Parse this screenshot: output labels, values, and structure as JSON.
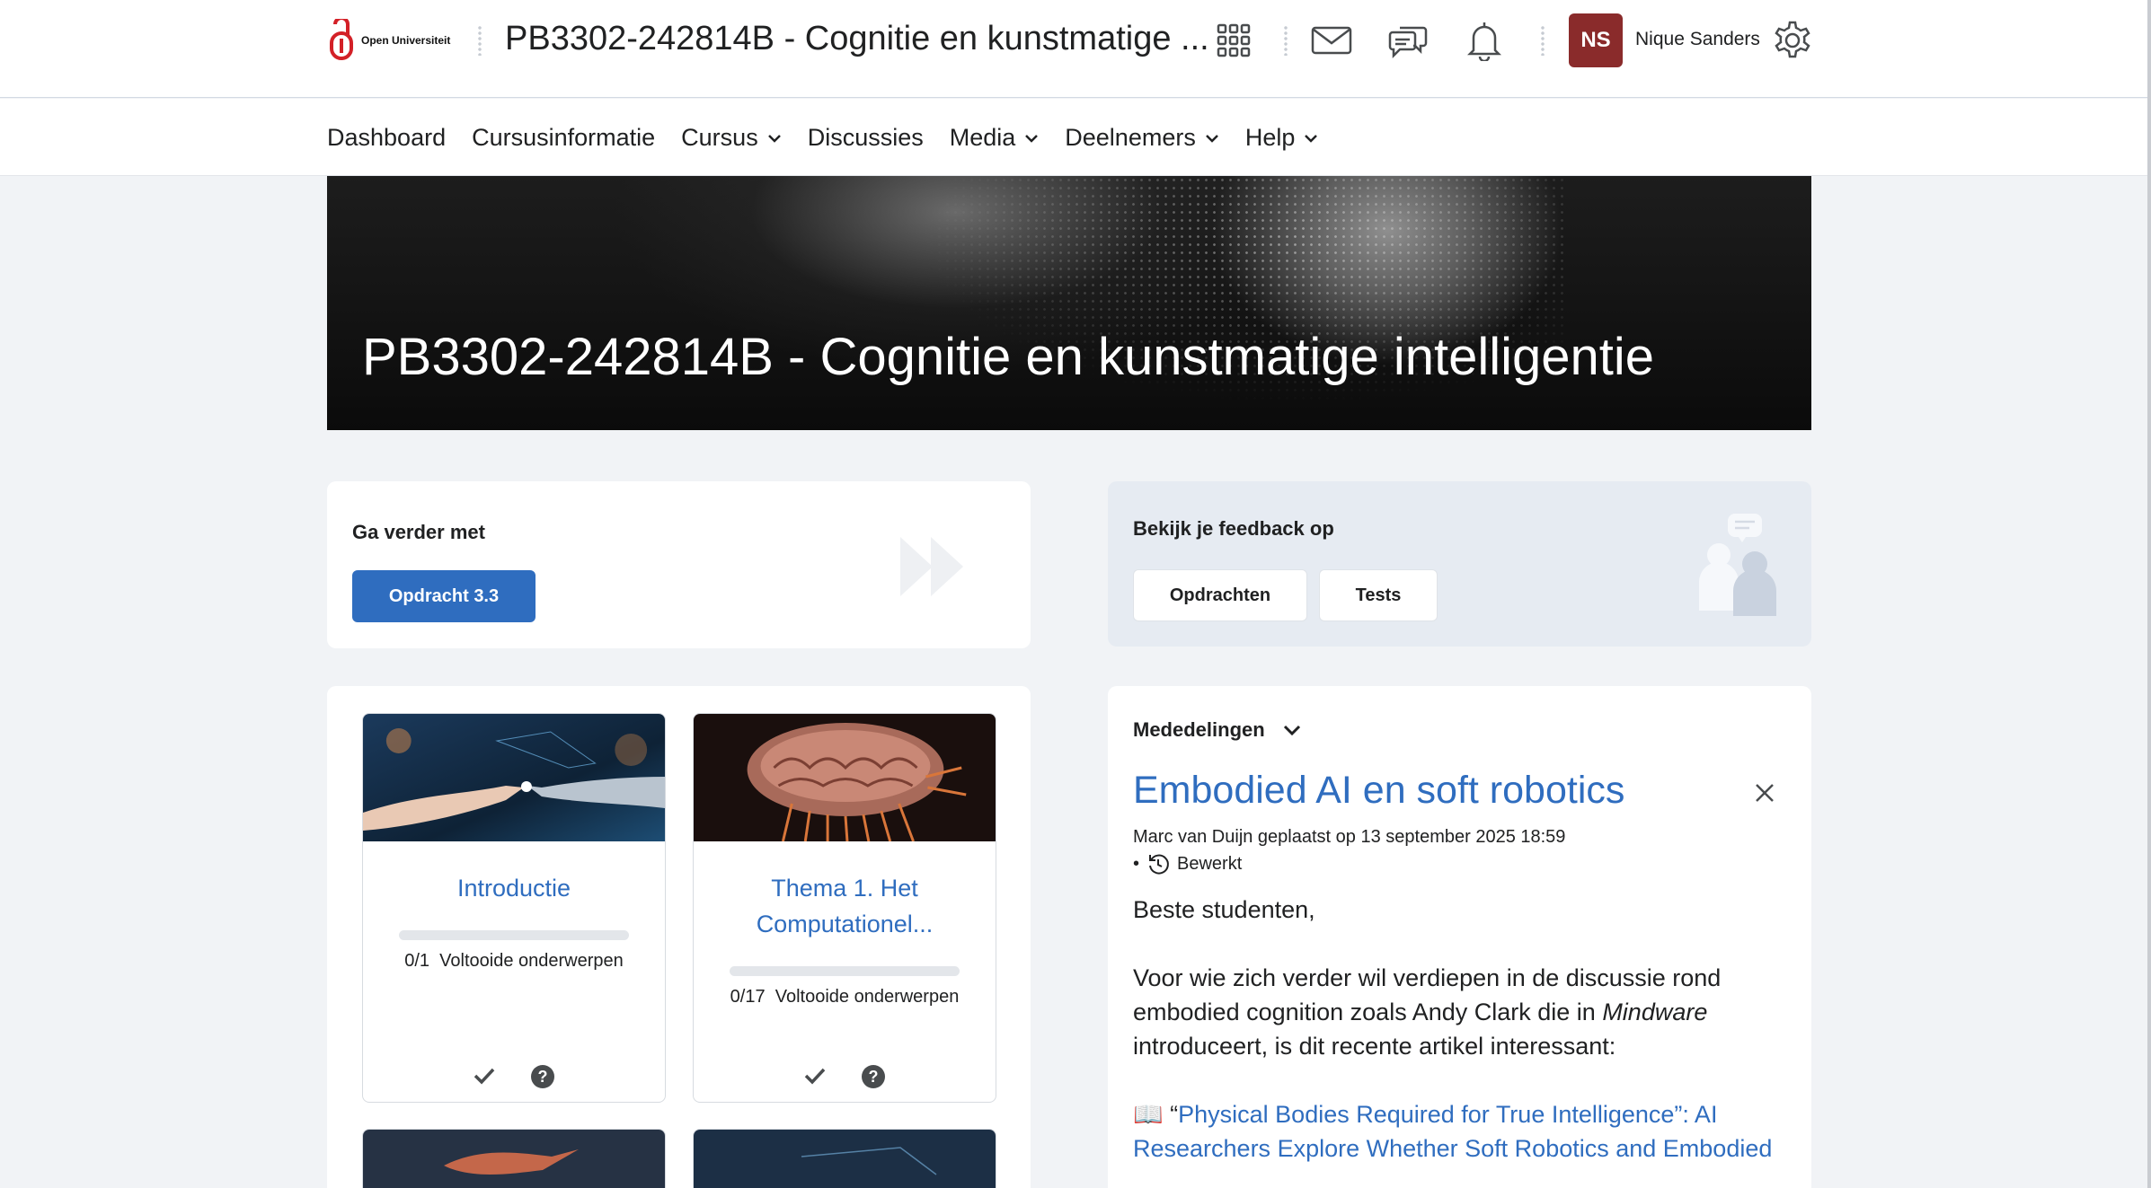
{
  "topbar": {
    "logo_text": "Open Universiteit",
    "course_title": "PB3302-242814B - Cognitie en kunstmatige ...",
    "avatar_initials": "NS",
    "user_name": "Nique Sanders",
    "icons": [
      "app-grid-icon",
      "mail-icon",
      "chat-icon",
      "bell-icon",
      "gear-icon"
    ]
  },
  "nav": {
    "items": [
      {
        "label": "Dashboard",
        "dropdown": false
      },
      {
        "label": "Cursusinformatie",
        "dropdown": false
      },
      {
        "label": "Cursus",
        "dropdown": true
      },
      {
        "label": "Discussies",
        "dropdown": false
      },
      {
        "label": "Media",
        "dropdown": true
      },
      {
        "label": "Deelnemers",
        "dropdown": true
      },
      {
        "label": "Help",
        "dropdown": true
      }
    ]
  },
  "banner": {
    "title": "PB3302-242814B - Cognitie en kunstmatige intelligentie"
  },
  "continue": {
    "heading": "Ga verder met",
    "button": "Opdracht 3.3"
  },
  "feedback": {
    "heading": "Bekijk je feedback op",
    "button_assignments": "Opdrachten",
    "button_tests": "Tests"
  },
  "modules": [
    {
      "title": "Introductie",
      "completed": 0,
      "total": 1,
      "progress_text": "0/1",
      "progress_label": "Voltooide onderwerpen"
    },
    {
      "title": "Thema 1. Het Computationel...",
      "completed": 0,
      "total": 17,
      "progress_text": "0/17",
      "progress_label": "Voltooide onderwerpen"
    }
  ],
  "announcements": {
    "heading": "Mededelingen",
    "title": "Embodied AI en soft robotics",
    "meta": "Marc van Duijn geplaatst op 13 september 2025 18:59",
    "edited": "Bewerkt",
    "greeting": "Beste studenten,",
    "para_start": "Voor wie zich verder wil verdiepen in de discussie rond embodied cognition zoals Andy Clark die in ",
    "para_book": "Mindware",
    "para_end": " introduceert, is dit recente artikel interessant:",
    "link_prefix": "📖 “",
    "link_text": "Physical Bodies Required for True Intelligence”: AI Researchers Explore Whether Soft Robotics and Embodied"
  },
  "colors": {
    "accent": "#2f6dbf",
    "avatar": "#8a2b2b",
    "logo_red": "#d32027"
  }
}
